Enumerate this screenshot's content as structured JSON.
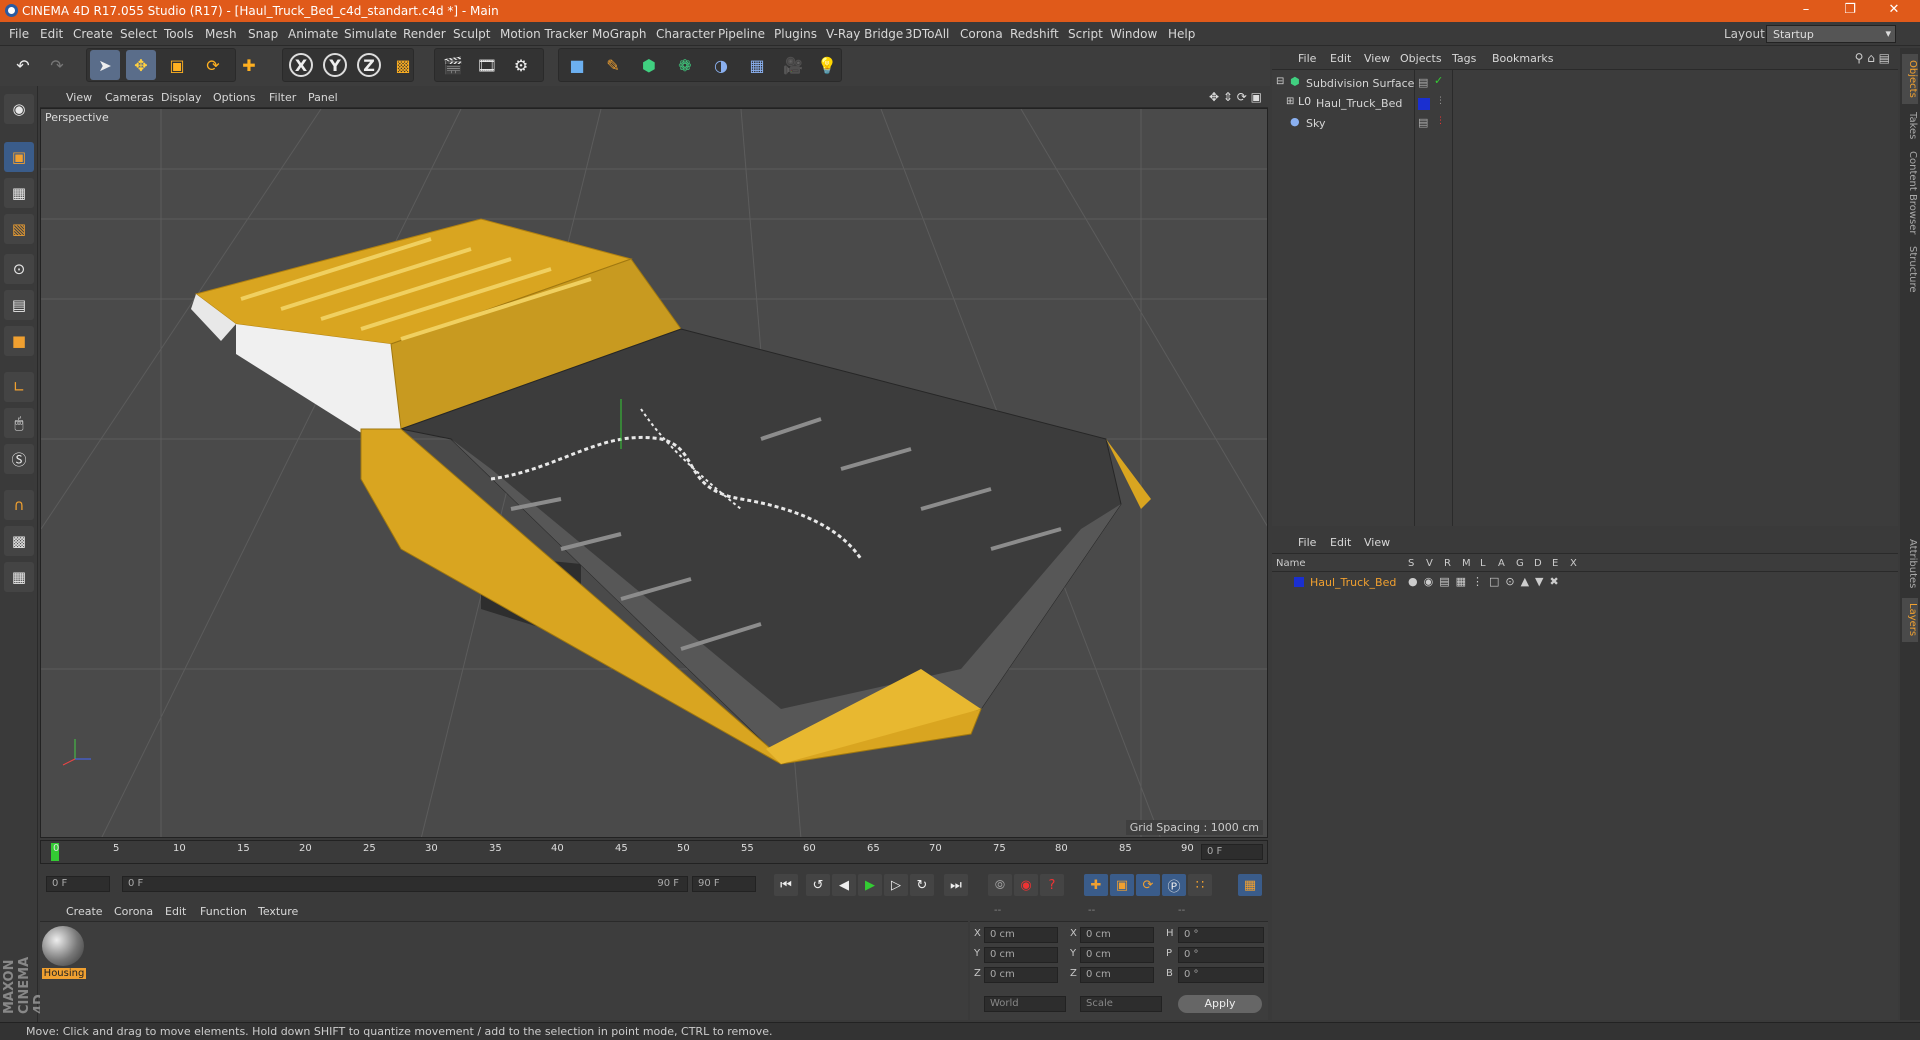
{
  "window": {
    "title": "CINEMA 4D R17.055 Studio (R17) - [Haul_Truck_Bed_c4d_standart.c4d *] - Main",
    "controls": [
      "–",
      "❐",
      "✕"
    ]
  },
  "menu": [
    "File",
    "Edit",
    "Create",
    "Select",
    "Tools",
    "Mesh",
    "Snap",
    "Animate",
    "Simulate",
    "Render",
    "Sculpt",
    "Motion Tracker",
    "MoGraph",
    "Character",
    "Pipeline",
    "Plugins",
    "V-Ray Bridge",
    "3DToAll",
    "Corona",
    "Redshift",
    "Script",
    "Window",
    "Help"
  ],
  "layout": {
    "label": "Layout:",
    "value": "Startup"
  },
  "toolbar": {
    "axis": [
      "X",
      "Y",
      "Z"
    ]
  },
  "viewport": {
    "menu": [
      "View",
      "Cameras",
      "Display",
      "Options",
      "Filter",
      "Panel"
    ],
    "label": "Perspective",
    "grid_spacing": "Grid Spacing : 1000 cm"
  },
  "timeline": {
    "ticks": [
      "0",
      "5",
      "10",
      "15",
      "20",
      "25",
      "30",
      "35",
      "40",
      "45",
      "50",
      "55",
      "60",
      "65",
      "70",
      "75",
      "80",
      "85",
      "90"
    ],
    "current_frame": "0 F",
    "start": "0 F",
    "range_start": "0 F",
    "range_end": "90 F",
    "end": "90 F"
  },
  "material_manager": {
    "menu": [
      "Create",
      "Corona",
      "Edit",
      "Function",
      "Texture"
    ],
    "material_name": "Housing"
  },
  "coordinates": {
    "header": [
      "--",
      "--",
      "--"
    ],
    "rows": [
      {
        "a": "X",
        "v1": "0 cm",
        "b": "X",
        "v2": "0 cm",
        "c": "H",
        "v3": "0 °"
      },
      {
        "a": "Y",
        "v1": "0 cm",
        "b": "Y",
        "v2": "0 cm",
        "c": "P",
        "v3": "0 °"
      },
      {
        "a": "Z",
        "v1": "0 cm",
        "b": "Z",
        "v2": "0 cm",
        "c": "B",
        "v3": "0 °"
      }
    ],
    "mode1": "World",
    "mode2": "Scale",
    "apply": "Apply"
  },
  "object_manager": {
    "menu": [
      "File",
      "Edit",
      "View",
      "Objects",
      "Tags",
      "Bookmarks"
    ],
    "objects": [
      {
        "name": "Subdivision Surface"
      },
      {
        "name": "Haul_Truck_Bed"
      },
      {
        "name": "Sky"
      }
    ]
  },
  "layer_manager": {
    "menu": [
      "File",
      "Edit",
      "View"
    ],
    "columns": [
      "Name",
      "S",
      "V",
      "R",
      "M",
      "L",
      "A",
      "G",
      "D",
      "E",
      "X"
    ],
    "layers": [
      {
        "name": "Haul_Truck_Bed"
      }
    ]
  },
  "side_tabs": [
    "Objects",
    "Takes",
    "Content Browser",
    "Structure",
    "Attributes",
    "Layers"
  ],
  "branding": "MAXON CINEMA 4D",
  "status": "Move: Click and drag to move elements. Hold down SHIFT to quantize movement / add to the selection in point mode, CTRL to remove.",
  "colors": {
    "titlebar": "#e05a1a",
    "accent_orange": "#f0a030",
    "bed_yellow": "#d9a520",
    "layer_blue": "#1a2fd0"
  }
}
